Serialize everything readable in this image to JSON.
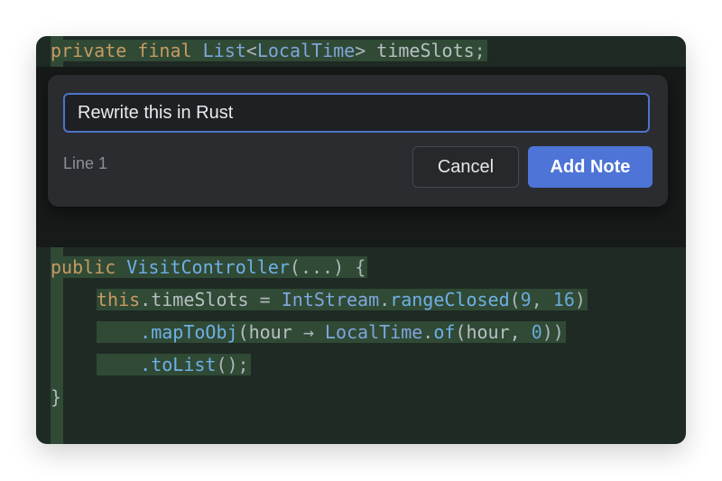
{
  "code": {
    "top_line": [
      "private",
      "final",
      "List",
      "<",
      "LocalTime",
      ">",
      "timeSlots",
      ";"
    ],
    "line_ctor": [
      "public",
      "VisitController",
      "(...)",
      "{"
    ],
    "line_assign": [
      "this",
      ".timeSlots",
      "=",
      "IntStream",
      ".",
      "rangeClosed",
      "(",
      "9",
      ", ",
      "16",
      ")"
    ],
    "line_map": [
      ".mapToObj",
      "(hour",
      "→",
      "LocalTime",
      ".",
      "of",
      "(hour, ",
      "0",
      "))"
    ],
    "line_tolist": [
      ".toList",
      "();"
    ],
    "line_close": "}"
  },
  "dialog": {
    "input_value": "Rewrite this in Rust",
    "line_label": "Line 1",
    "cancel_label": "Cancel",
    "add_label": "Add Note"
  },
  "colors": {
    "accent": "#4d74d6",
    "highlight": "#304a35",
    "editor_bg": "#1f2a24",
    "dialog_bg": "#2a2c30"
  }
}
